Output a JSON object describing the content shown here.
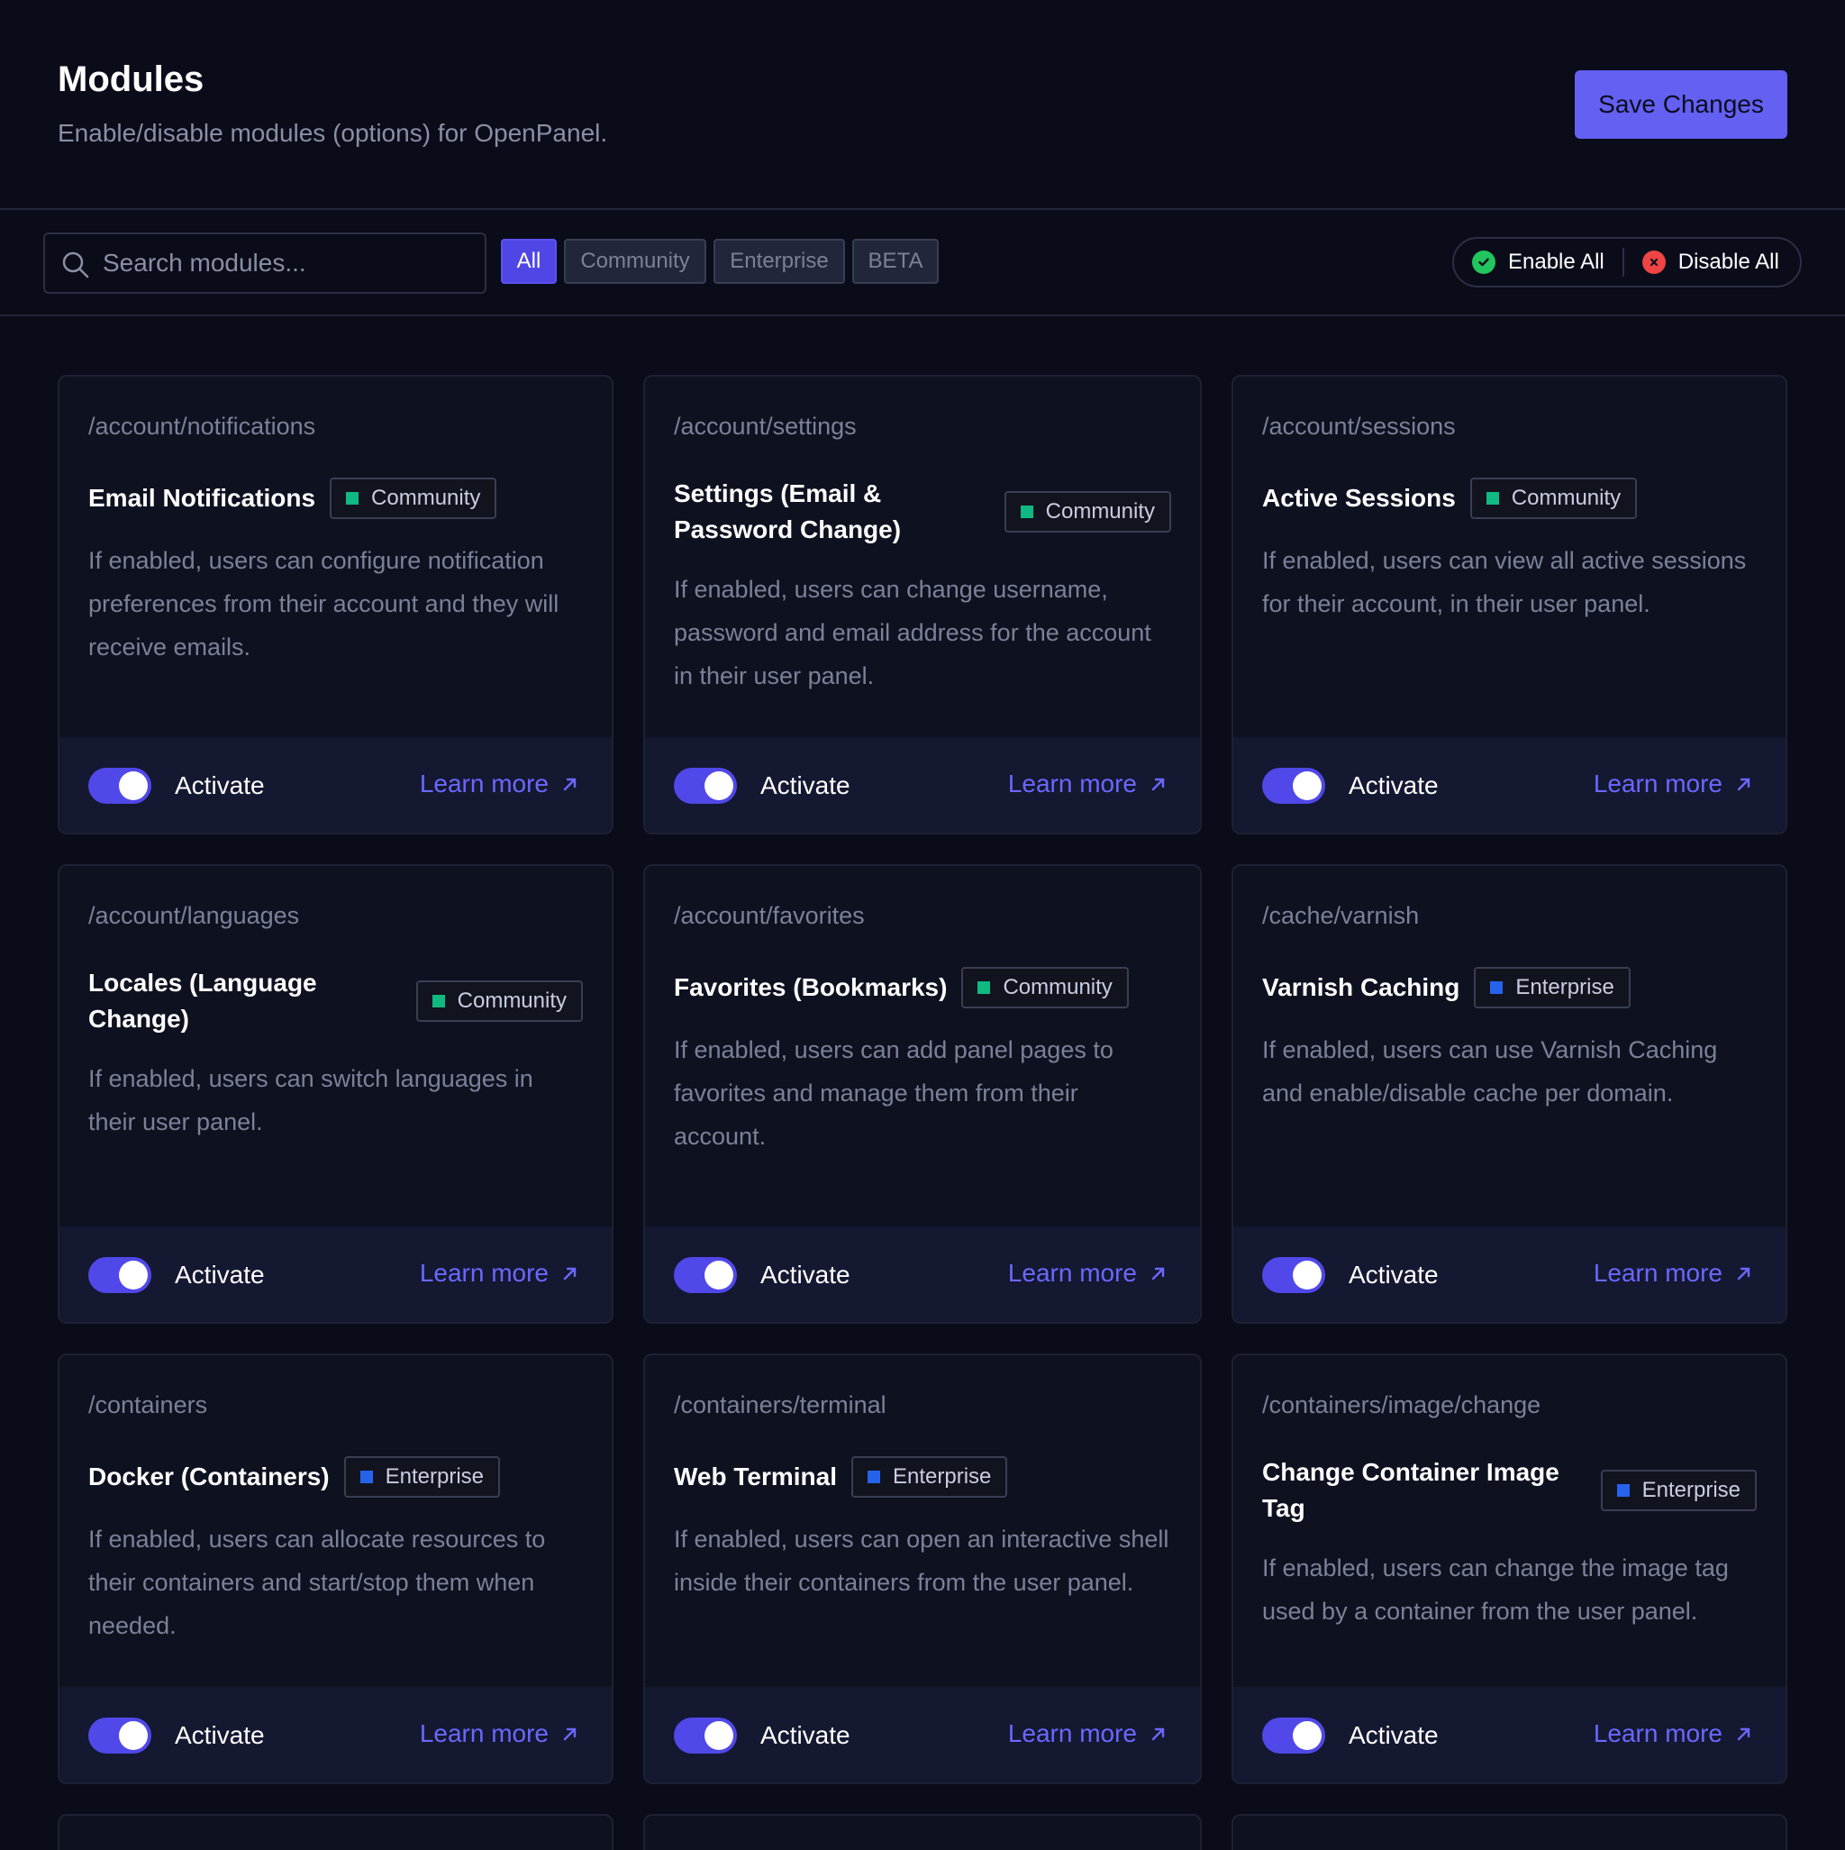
{
  "header": {
    "title": "Modules",
    "subtitle": "Enable/disable modules (options) for OpenPanel.",
    "save_label": "Save Changes"
  },
  "toolbar": {
    "search_placeholder": "Search modules...",
    "filters": [
      "All",
      "Community",
      "Enterprise",
      "BETA"
    ],
    "active_filter": "All",
    "enable_all": "Enable All",
    "disable_all": "Disable All"
  },
  "colors": {
    "accent": "#6360f2",
    "community": "#10b981",
    "enterprise": "#2563eb",
    "enable": "#22c55e",
    "disable": "#ef4444"
  },
  "card_labels": {
    "activate": "Activate",
    "learn_more": "Learn more"
  },
  "modules": [
    {
      "path": "/account/notifications",
      "title": "Email Notifications",
      "badge": "Community",
      "enabled": true,
      "description": "If enabled, users can configure notification preferences from their account and they will receive emails."
    },
    {
      "path": "/account/settings",
      "title": "Settings (Email & Password Change)",
      "badge": "Community",
      "enabled": true,
      "description": "If enabled, users can change username, password and email address for the account in their user panel."
    },
    {
      "path": "/account/sessions",
      "title": "Active Sessions",
      "badge": "Community",
      "enabled": true,
      "description": "If enabled, users can view all active sessions for their account, in their user panel."
    },
    {
      "path": "/account/languages",
      "title": "Locales (Language Change)",
      "badge": "Community",
      "enabled": true,
      "description": "If enabled, users can switch languages in their user panel."
    },
    {
      "path": "/account/favorites",
      "title": "Favorites (Bookmarks)",
      "badge": "Community",
      "enabled": true,
      "description": "If enabled, users can add panel pages to favorites and manage them from their account."
    },
    {
      "path": "/cache/varnish",
      "title": "Varnish Caching",
      "badge": "Enterprise",
      "enabled": true,
      "description": "If enabled, users can use Varnish Caching and enable/disable cache per domain."
    },
    {
      "path": "/containers",
      "title": "Docker (Containers)",
      "badge": "Enterprise",
      "enabled": true,
      "description": "If enabled, users can allocate resources to their containers and start/stop them when needed."
    },
    {
      "path": "/containers/terminal",
      "title": "Web Terminal",
      "badge": "Enterprise",
      "enabled": true,
      "description": "If enabled, users can open an interactive shell inside their containers from the user panel."
    },
    {
      "path": "/containers/image/change",
      "title": "Change Container Image Tag",
      "badge": "Enterprise",
      "enabled": true,
      "description": "If enabled, users can change the image tag used by a container from the user panel."
    }
  ]
}
